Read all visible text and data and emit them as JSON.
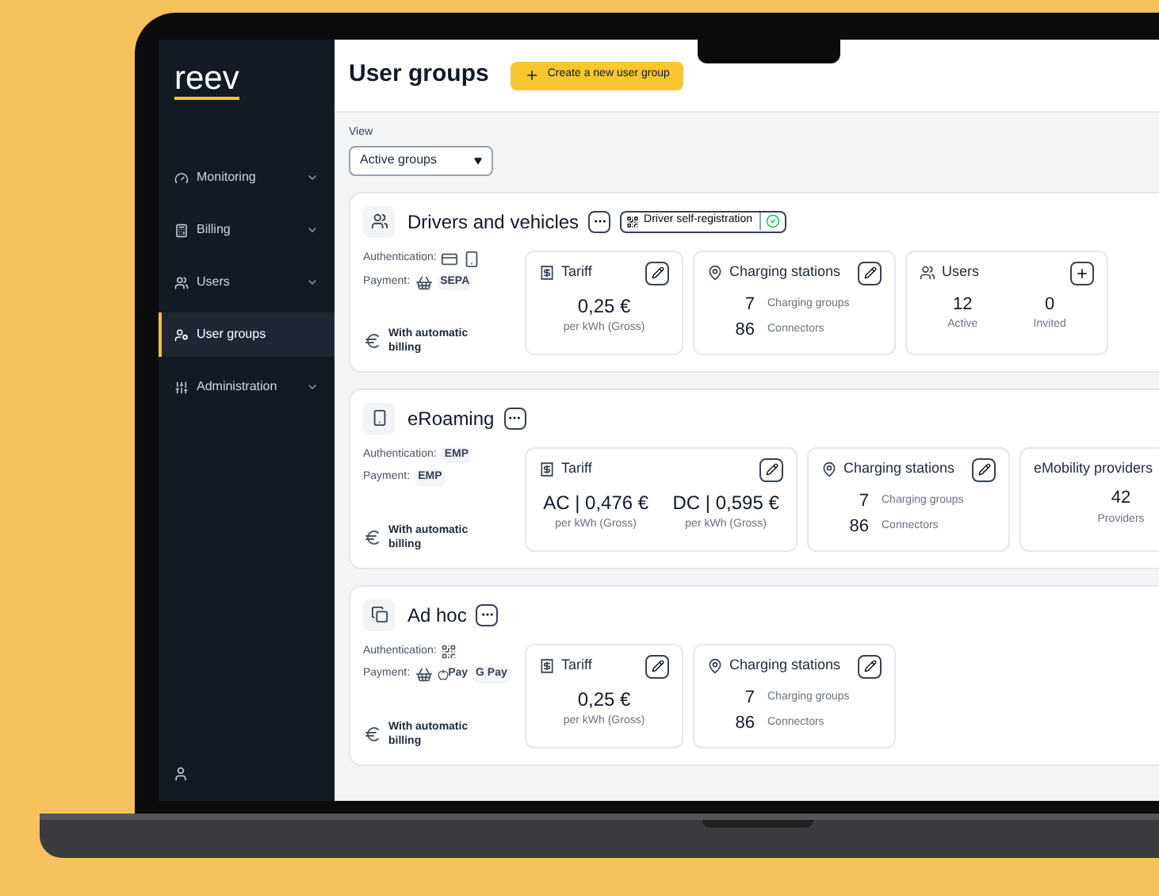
{
  "brand": "reev",
  "sidebar": {
    "items": [
      {
        "label": "Monitoring",
        "expandable": true,
        "selected": false
      },
      {
        "label": "Billing",
        "expandable": true,
        "selected": false
      },
      {
        "label": "Users",
        "expandable": true,
        "selected": false
      },
      {
        "label": "User groups",
        "expandable": false,
        "selected": true
      },
      {
        "label": "Administration",
        "expandable": true,
        "selected": false
      }
    ]
  },
  "header": {
    "title": "User groups",
    "create_button": "Create a new user group"
  },
  "view": {
    "label": "View",
    "value": "Active groups"
  },
  "groups": [
    {
      "name": "Drivers and vehicles",
      "badges": [
        {
          "label": "Driver self-registration",
          "checked": true
        }
      ],
      "authentication_label": "Authentication:",
      "authentication": [
        {
          "kind": "card"
        },
        {
          "kind": "phone"
        }
      ],
      "payment_label": "Payment:",
      "payment": [
        {
          "kind": "basket"
        },
        {
          "kind": "text",
          "label": "SEPA"
        }
      ],
      "billing": "With automatic billing",
      "panels": [
        {
          "kind": "tariff",
          "title": "Tariff",
          "prices": [
            {
              "amount": "0,25 €",
              "unit": "per kWh (Gross)"
            }
          ]
        },
        {
          "kind": "stations",
          "title": "Charging stations",
          "rows": [
            {
              "value": "7",
              "label": "Charging groups"
            },
            {
              "value": "86",
              "label": "Connectors"
            }
          ]
        },
        {
          "kind": "users",
          "title": "Users",
          "counts": [
            {
              "value": "12",
              "label": "Active"
            },
            {
              "value": "0",
              "label": "Invited"
            }
          ]
        }
      ]
    },
    {
      "name": "eRoaming",
      "authentication_label": "Authentication:",
      "authentication": [
        {
          "kind": "text",
          "label": "EMP"
        }
      ],
      "payment_label": "Payment:",
      "payment": [
        {
          "kind": "text",
          "label": "EMP"
        }
      ],
      "billing": "With automatic billing",
      "panels": [
        {
          "kind": "tariff",
          "title": "Tariff",
          "prices": [
            {
              "amount": "AC | 0,476 €",
              "unit": "per kWh (Gross)"
            },
            {
              "amount": "DC | 0,595 €",
              "unit": "per kWh (Gross)"
            }
          ]
        },
        {
          "kind": "stations",
          "title": "Charging stations",
          "rows": [
            {
              "value": "7",
              "label": "Charging groups"
            },
            {
              "value": "86",
              "label": "Connectors"
            }
          ]
        },
        {
          "kind": "providers",
          "title": "eMobility providers",
          "counts": [
            {
              "value": "42",
              "label": "Providers"
            }
          ]
        }
      ]
    },
    {
      "name": "Ad hoc",
      "authentication_label": "Authentication:",
      "authentication": [
        {
          "kind": "qr"
        }
      ],
      "payment_label": "Payment:",
      "payment": [
        {
          "kind": "basket"
        },
        {
          "kind": "apple",
          "label": "Pay"
        },
        {
          "kind": "text",
          "label": "G Pay"
        }
      ],
      "billing": "With automatic billing",
      "panels": [
        {
          "kind": "tariff",
          "title": "Tariff",
          "prices": [
            {
              "amount": "0,25 €",
              "unit": "per kWh (Gross)"
            }
          ]
        },
        {
          "kind": "stations",
          "title": "Charging stations",
          "rows": [
            {
              "value": "7",
              "label": "Charging groups"
            },
            {
              "value": "86",
              "label": "Connectors"
            }
          ]
        }
      ]
    }
  ]
}
